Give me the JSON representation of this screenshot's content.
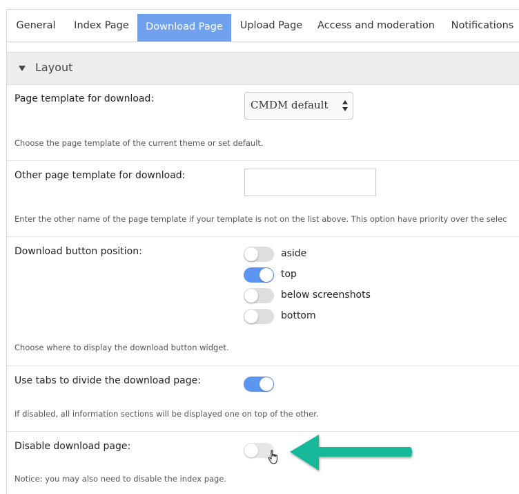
{
  "tabs": [
    {
      "label": "General",
      "active": false
    },
    {
      "label": "Index Page",
      "active": false
    },
    {
      "label": "Download Page",
      "active": true
    },
    {
      "label": "Upload Page",
      "active": false
    },
    {
      "label": "Access and moderation",
      "active": false
    },
    {
      "label": "Notifications",
      "active": false
    }
  ],
  "section": {
    "title": "Layout",
    "icon": "triangle-down-icon"
  },
  "page_template": {
    "label": "Page template for download:",
    "selected": "CMDM default",
    "description": "Choose the page template of the current theme or set default."
  },
  "other_template": {
    "label": "Other page template for download:",
    "value": "",
    "description": "Enter the other name of the page template if your template is not on the list above. This option have priority over the selec"
  },
  "button_position": {
    "label": "Download button position:",
    "options": [
      {
        "label": "aside",
        "on": false
      },
      {
        "label": "top",
        "on": true
      },
      {
        "label": "below screenshots",
        "on": false
      },
      {
        "label": "bottom",
        "on": false
      }
    ],
    "description": "Choose where to display the download button widget."
  },
  "use_tabs": {
    "label": "Use tabs to divide the download page:",
    "on": true,
    "description": "If disabled, all information sections will be displayed one on top of the other."
  },
  "disable_page": {
    "label": "Disable download page:",
    "on": false,
    "description": "Notice: you may also need to disable the index page."
  },
  "colors": {
    "accent": "#6fa1ee",
    "toggle_on": "#5d95f2",
    "toggle_off": "#dedede",
    "callout_arrow": "#12b89a"
  }
}
